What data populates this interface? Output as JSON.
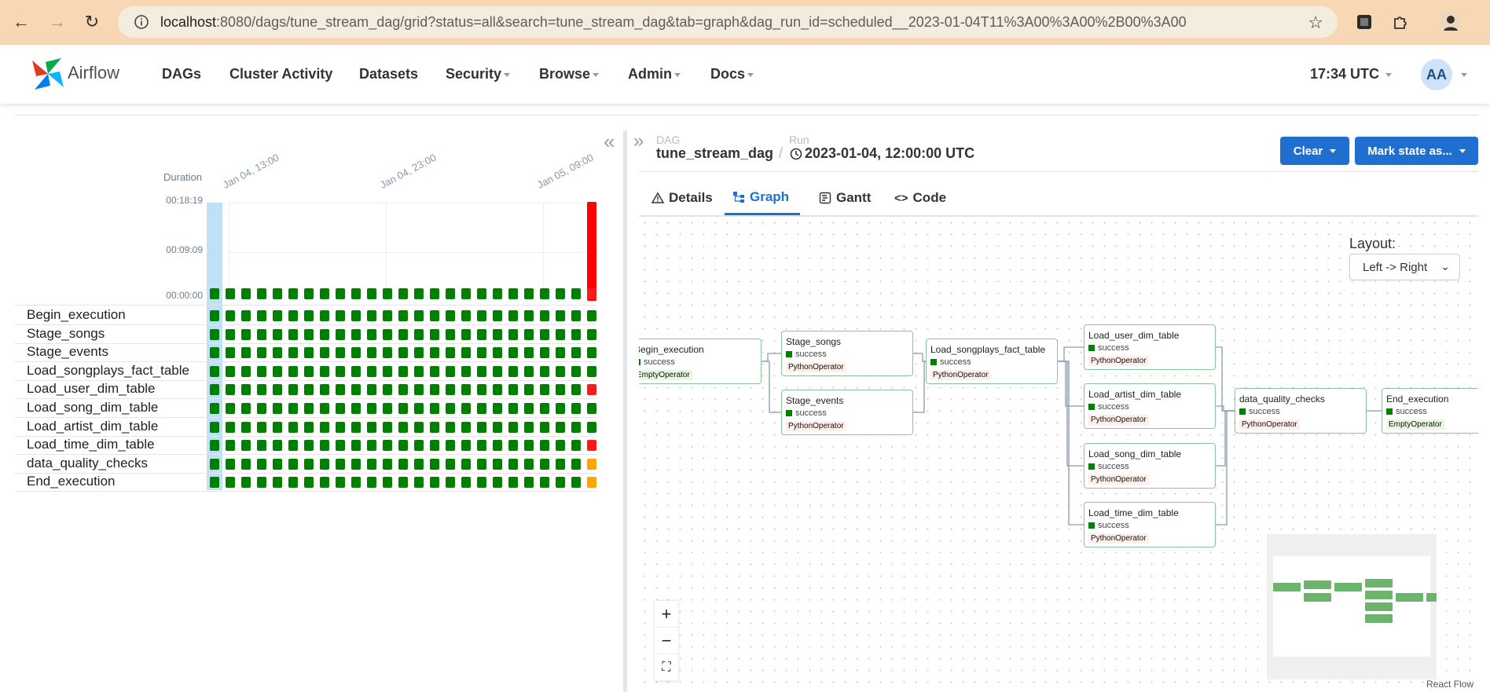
{
  "browser": {
    "url_host": "localhost",
    "url_rest": ":8080/dags/tune_stream_dag/grid?status=all&search=tune_stream_dag&tab=graph&dag_run_id=scheduled__2023-01-04T11%3A00%3A00%2B00%3A00"
  },
  "navbar": {
    "brand": "Airflow",
    "items": [
      "DAGs",
      "Cluster Activity",
      "Datasets",
      "Security",
      "Browse",
      "Admin",
      "Docs"
    ],
    "clock": "17:34 UTC",
    "avatar": "AA"
  },
  "grid": {
    "duration_label": "Duration",
    "duration_ticks": [
      "00:18:19",
      "00:09:09",
      "00:00:00"
    ],
    "date_labels": [
      "Jan 04, 13:00",
      "Jan 04, 23:00",
      "Jan 05, 09:00"
    ],
    "tasks": [
      "Begin_execution",
      "Stage_songs",
      "Stage_events",
      "Load_songplays_fact_table",
      "Load_user_dim_table",
      "Load_song_dim_table",
      "Load_artist_dim_table",
      "Load_time_dim_table",
      "data_quality_checks",
      "End_execution"
    ],
    "columns": 25,
    "last_column_states": [
      "success",
      "success",
      "success",
      "success",
      "failed",
      "success",
      "success",
      "failed",
      "upstream_failed",
      "upstream_failed"
    ],
    "colors": {
      "success": "#008000",
      "failed": "#ff1a1a",
      "upstream_failed": "#ffa500",
      "selected": "#bfe0f5"
    }
  },
  "header": {
    "dag_label": "DAG",
    "dag_value": "tune_stream_dag",
    "run_label": "Run",
    "run_value": "2023-01-04, 12:00:00 UTC",
    "clear_button": "Clear",
    "mark_state_button": "Mark state as..."
  },
  "tabs": [
    "Details",
    "Graph",
    "Gantt",
    "Code"
  ],
  "graph": {
    "layout_label": "Layout:",
    "layout_value": "Left -> Right",
    "nodes": [
      {
        "id": "begin",
        "title": "Begin_execution",
        "state": "success",
        "operator": "EmptyOperator"
      },
      {
        "id": "stage_songs",
        "title": "Stage_songs",
        "state": "success",
        "operator": "PythonOperator"
      },
      {
        "id": "stage_events",
        "title": "Stage_events",
        "state": "success",
        "operator": "PythonOperator"
      },
      {
        "id": "songplays",
        "title": "Load_songplays_fact_table",
        "state": "success",
        "operator": "PythonOperator"
      },
      {
        "id": "user_dim",
        "title": "Load_user_dim_table",
        "state": "success",
        "operator": "PythonOperator"
      },
      {
        "id": "artist_dim",
        "title": "Load_artist_dim_table",
        "state": "success",
        "operator": "PythonOperator"
      },
      {
        "id": "song_dim",
        "title": "Load_song_dim_table",
        "state": "success",
        "operator": "PythonOperator"
      },
      {
        "id": "time_dim",
        "title": "Load_time_dim_table",
        "state": "success",
        "operator": "PythonOperator"
      },
      {
        "id": "dq",
        "title": "data_quality_checks",
        "state": "success",
        "operator": "PythonOperator"
      },
      {
        "id": "end",
        "title": "End_execution",
        "state": "success",
        "operator": "EmptyOperator"
      }
    ],
    "zoom_in": "+",
    "zoom_out": "−",
    "fit_view": "⛶",
    "attribution": "React Flow"
  }
}
